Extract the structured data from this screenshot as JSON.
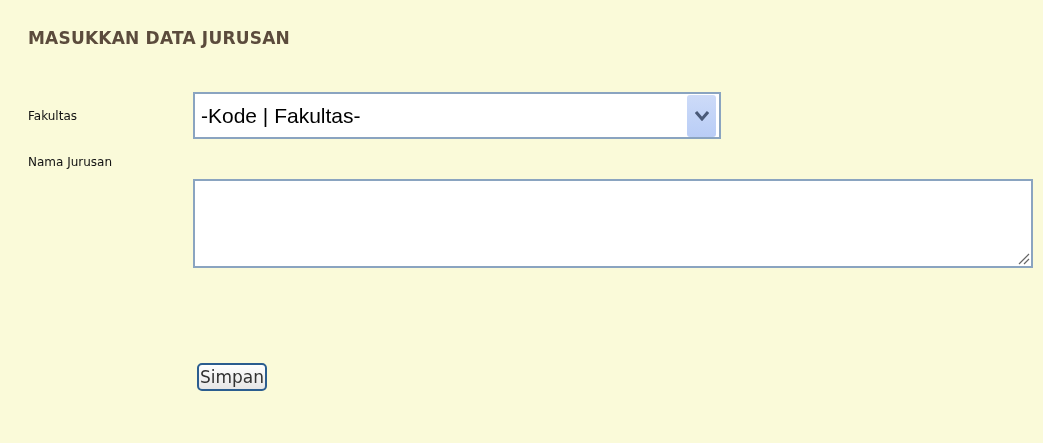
{
  "heading": "MASUKKAN DATA JURUSAN",
  "fields": [
    {
      "kind": "select",
      "label": "Fakultas",
      "value": "-Kode | Fakultas-"
    },
    {
      "kind": "textarea",
      "label": "Nama Jurusan"
    }
  ],
  "submit": {
    "label": "Simpan"
  }
}
